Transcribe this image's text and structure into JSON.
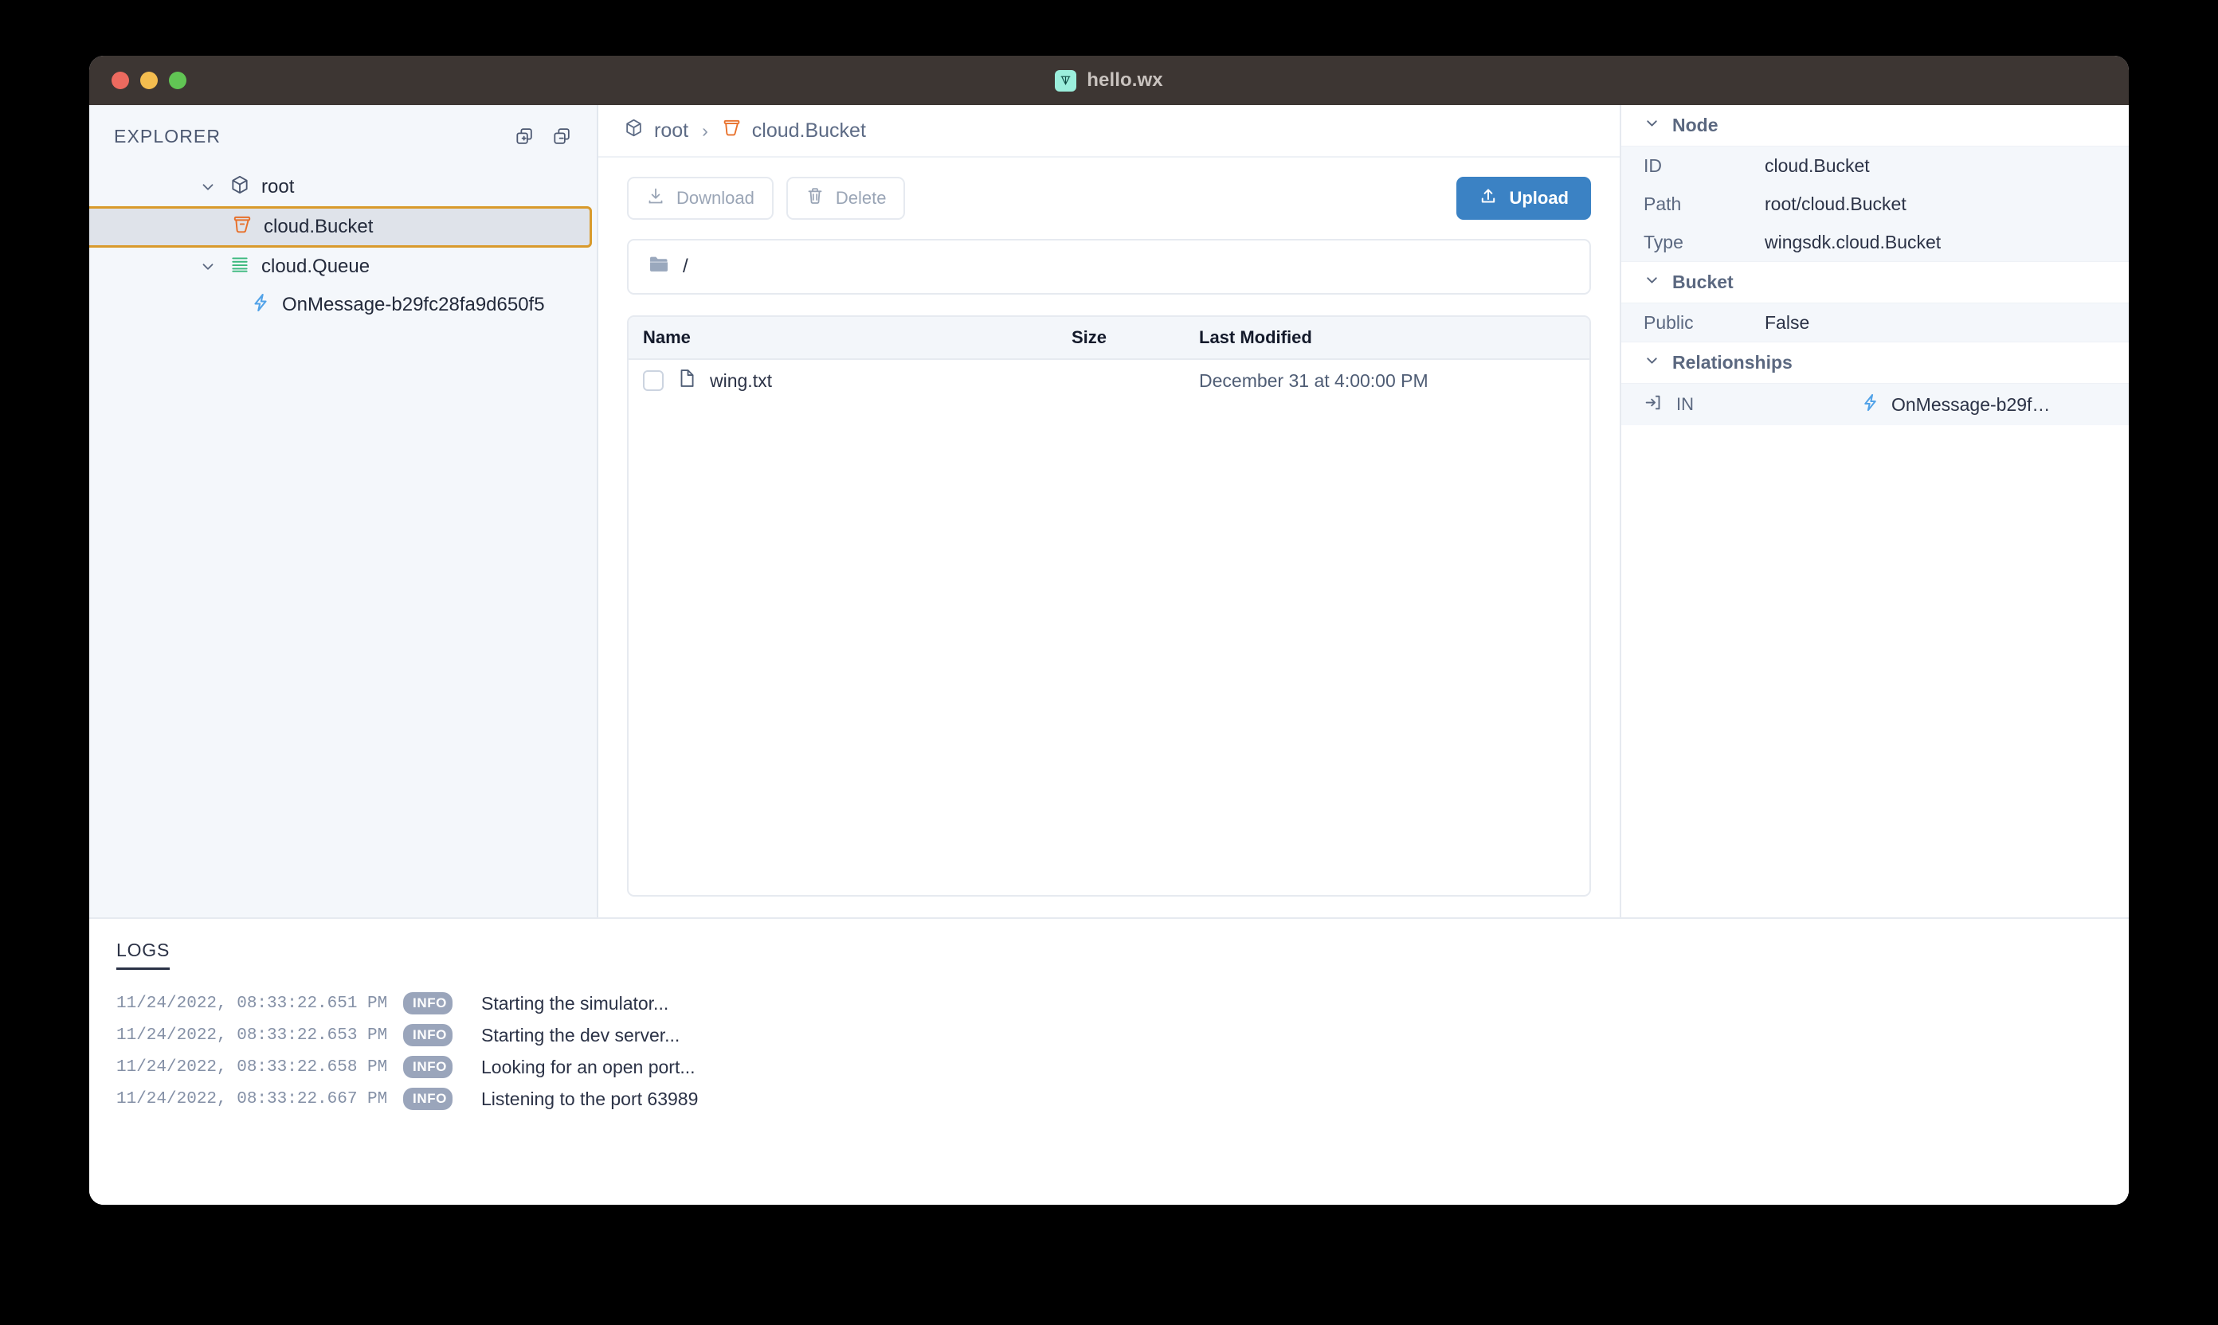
{
  "window": {
    "title": "hello.wx",
    "logo_icon": "wing-logo-icon",
    "traffic_lights": [
      "close",
      "minimize",
      "maximize"
    ]
  },
  "sidebar": {
    "title": "EXPLORER",
    "actions": [
      {
        "name": "expand-all-icon",
        "label": "Expand All"
      },
      {
        "name": "collapse-all-icon",
        "label": "Collapse All"
      }
    ],
    "tree": [
      {
        "label": "root",
        "icon": "cube-icon",
        "level": 0,
        "expanded": true,
        "selected": false
      },
      {
        "label": "cloud.Bucket",
        "icon": "bucket-icon",
        "level": 1,
        "expanded": null,
        "selected": true
      },
      {
        "label": "cloud.Queue",
        "icon": "queue-icon",
        "level": 1,
        "expanded": true,
        "selected": false
      },
      {
        "label": "OnMessage-b29fc28fa9d650f5",
        "icon": "function-icon",
        "level": 2,
        "expanded": null,
        "selected": false
      }
    ]
  },
  "breadcrumb": {
    "items": [
      {
        "label": "root",
        "icon": "cube-icon"
      },
      {
        "label": "cloud.Bucket",
        "icon": "bucket-icon"
      }
    ],
    "separator": "›"
  },
  "toolbar": {
    "download_label": "Download",
    "download_icon": "download-icon",
    "download_disabled": true,
    "delete_label": "Delete",
    "delete_icon": "trash-icon",
    "delete_disabled": true,
    "upload_label": "Upload",
    "upload_icon": "upload-icon"
  },
  "pathbar": {
    "icon": "folder-icon",
    "value": "/"
  },
  "filelist": {
    "columns": [
      "Name",
      "Size",
      "Last Modified"
    ],
    "rows": [
      {
        "name": "wing.txt",
        "icon": "file-icon",
        "size": "",
        "modified": "December 31 at 4:00:00 PM",
        "checked": false
      }
    ]
  },
  "inspector": {
    "sections": [
      {
        "title": "Node",
        "expanded": true,
        "rows": [
          {
            "key": "ID",
            "value": "cloud.Bucket"
          },
          {
            "key": "Path",
            "value": "root/cloud.Bucket"
          },
          {
            "key": "Type",
            "value": "wingsdk.cloud.Bucket"
          }
        ]
      },
      {
        "title": "Bucket",
        "expanded": true,
        "rows": [
          {
            "key": "Public",
            "value": "False"
          }
        ]
      },
      {
        "title": "Relationships",
        "expanded": true,
        "relations": [
          {
            "direction": "IN",
            "direction_icon": "arrow-into-box-icon",
            "target": "OnMessage-b29f…",
            "target_icon": "function-icon"
          }
        ]
      }
    ]
  },
  "logs": {
    "title": "LOGS",
    "entries": [
      {
        "time": "11/24/2022, 08:33:22.651 PM",
        "level": "INFO",
        "message": "Starting the simulator..."
      },
      {
        "time": "11/24/2022, 08:33:22.653 PM",
        "level": "INFO",
        "message": "Starting the dev server..."
      },
      {
        "time": "11/24/2022, 08:33:22.658 PM",
        "level": "INFO",
        "message": "Looking for an open port..."
      },
      {
        "time": "11/24/2022, 08:33:22.667 PM",
        "level": "INFO",
        "message": "Listening to the port 63989"
      }
    ]
  },
  "colors": {
    "titlebar": "#3d3633",
    "accent_blue": "#3b82c4",
    "bucket_orange": "#e8702a",
    "queue_green": "#3ab87d",
    "function_blue": "#51a2e8",
    "selection_border": "#d99a2b",
    "selection_fill": "#dfe3ea",
    "sidebar_bg": "#f4f7fb",
    "logo_bg": "#9beedc",
    "log_badge": "#9aa5bb"
  }
}
